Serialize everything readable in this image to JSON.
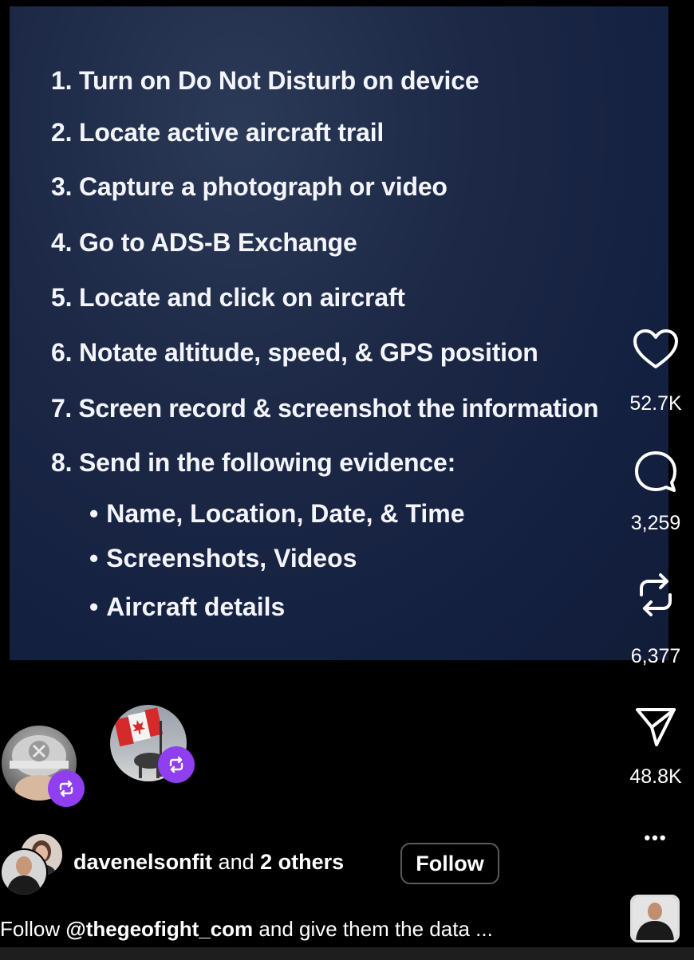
{
  "slide": {
    "steps": [
      "1. Turn on Do Not Disturb on device",
      "2. Locate active aircraft trail",
      "3. Capture a photograph or video",
      "4. Go to ADS-B Exchange",
      "5. Locate and click on aircraft",
      "6. Notate altitude, speed, & GPS position",
      "7. Screen record & screenshot the information",
      "8. Send in the following evidence:"
    ],
    "bullets": [
      "Name, Location, Date, & Time",
      "Screenshots, Videos",
      "Aircraft details"
    ]
  },
  "actions": {
    "like": {
      "icon": "heart-icon",
      "count": "52.7K"
    },
    "comment": {
      "icon": "comment-icon",
      "count": "3,259"
    },
    "repost": {
      "icon": "repost-icon",
      "count": "6,377"
    },
    "share": {
      "icon": "send-icon",
      "count": "48.8K"
    },
    "more": {
      "icon": "more-icon",
      "label": "•••"
    }
  },
  "likes": {
    "user": "davenelsonfit",
    "connector": " and ",
    "others": "2 others"
  },
  "follow_label": "Follow",
  "caption": {
    "prefix": "Follow ",
    "mention": "@thegeofight_com",
    "rest": " and give them the data ..."
  },
  "colors": {
    "repost_badge": "#8f3ff0",
    "slide_bg": "#1c2845"
  }
}
